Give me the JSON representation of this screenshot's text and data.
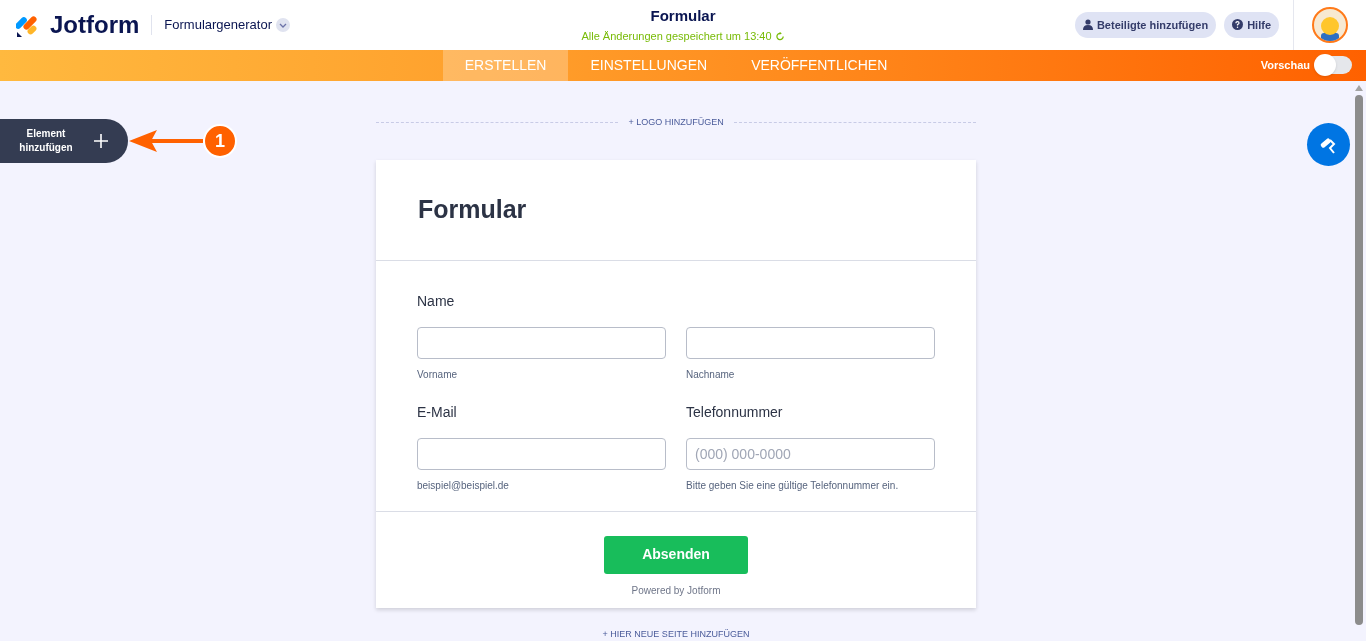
{
  "header": {
    "brand": "Jotform",
    "app_menu": "Formulargenerator",
    "title": "Formular",
    "save_status": "Alle Änderungen gespeichert um 13:40",
    "buttons": [
      {
        "kind": "person",
        "label": "Beteiligte hinzufügen"
      },
      {
        "kind": "help",
        "label": "Hilfe"
      }
    ]
  },
  "tabs": [
    {
      "label": "ERSTELLEN",
      "selected": true
    },
    {
      "label": "EINSTELLUNGEN",
      "selected": false
    },
    {
      "label": "VERÖFFENTLICHEN",
      "selected": false
    }
  ],
  "preview": {
    "label": "Vorschau",
    "on": false
  },
  "add_element": {
    "label": "Element hinzufügen"
  },
  "annotation": {
    "number": "1"
  },
  "logo_link": "+ LOGO HINZUFÜGEN",
  "form": {
    "title": "Formular",
    "rows": [
      {
        "fields": [
          {
            "label": "Name",
            "sublabel": "Vorname"
          },
          {
            "sublabel": "Nachname"
          }
        ]
      },
      {
        "fields": [
          {
            "label": "E-Mail",
            "sublabel": "beispiel@beispiel.de"
          },
          {
            "label": "Telefonnummer",
            "placeholder": "(000) 000-0000",
            "sublabel": "Bitte geben Sie eine gültige Telefonnummer ein."
          }
        ]
      }
    ],
    "submit": "Absenden",
    "powered_by": "Powered by Jotform"
  },
  "add_page_link": "+ HIER NEUE SEITE HINZUFÜGEN"
}
